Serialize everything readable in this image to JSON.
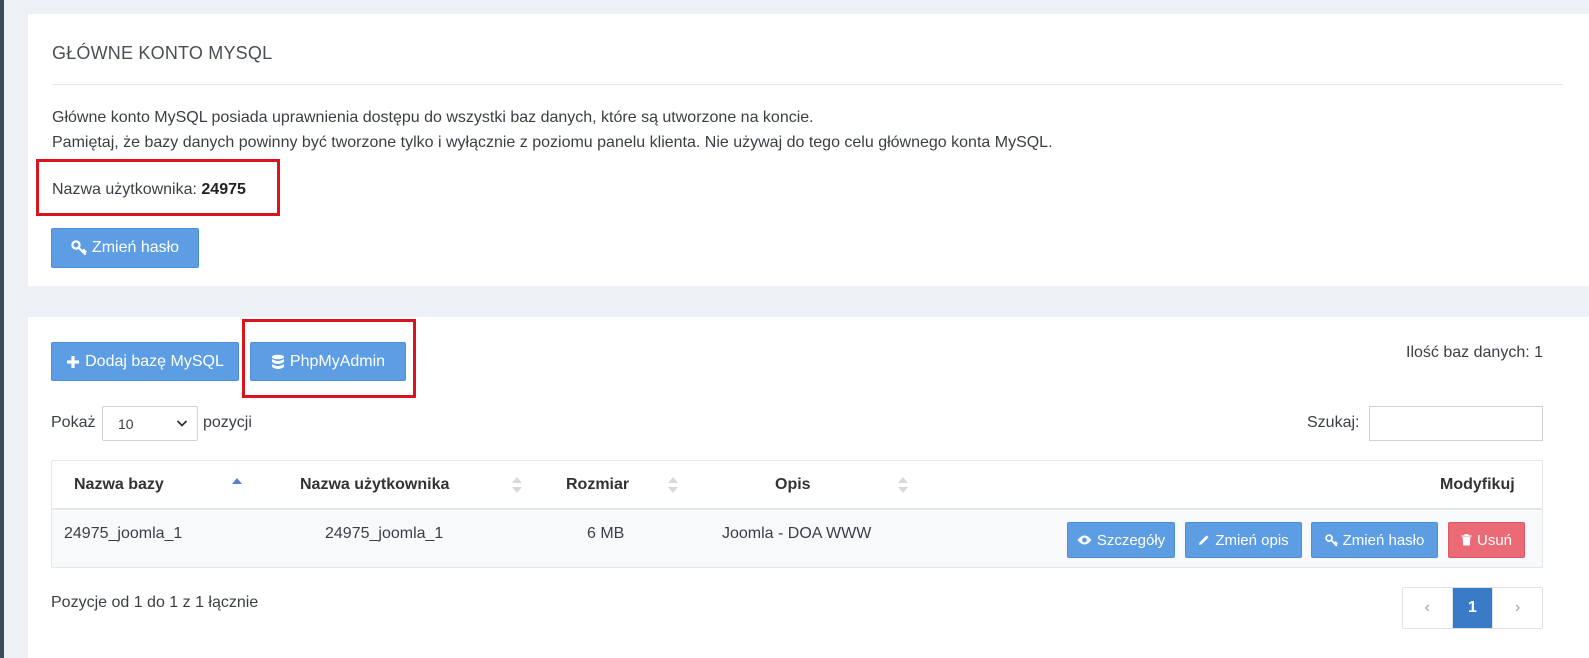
{
  "main_account": {
    "title": "GŁÓWNE KONTO MYSQL",
    "description_line1": "Główne konto MySQL posiada uprawnienia dostępu do wszystki baz danych, które są utworzone na koncie.",
    "description_line2": "Pamiętaj, że bazy danych powinny być tworzone tylko i wyłącznie z poziomu panelu klienta. Nie używaj do tego celu głównego konta MySQL.",
    "username_label": "Nazwa użytkownika:",
    "username_value": "24975",
    "change_password_label": "Zmień hasło"
  },
  "databases": {
    "add_button_label": "Dodaj bazę MySQL",
    "phpmyadmin_button_label": "PhpMyAdmin",
    "count_text": "Ilość baz danych: 1",
    "show_label": "Pokaż",
    "page_size": "10",
    "positions_label": "pozycji",
    "search_label": "Szukaj:",
    "search_value": "",
    "columns": [
      "Nazwa bazy",
      "Nazwa użytkownika",
      "Rozmiar",
      "Opis",
      "Modyfikuj"
    ],
    "rows": [
      {
        "name": "24975_joomla_1",
        "user": "24975_joomla_1",
        "size": "6 MB",
        "description": "Joomla - DOA WWW",
        "actions": [
          "Szczegóły",
          "Zmień opis",
          "Zmień hasło",
          "Usuń"
        ]
      }
    ],
    "summary": "Pozycje od 1 do 1 z 1 łącznie",
    "pagination": {
      "prev": "‹",
      "current": "1",
      "next": "›"
    }
  },
  "colors": {
    "primary_button": "#5d9de3",
    "danger_button": "#ea6a76",
    "highlight_border": "#d9141e",
    "active_page": "#3a7bc8"
  }
}
